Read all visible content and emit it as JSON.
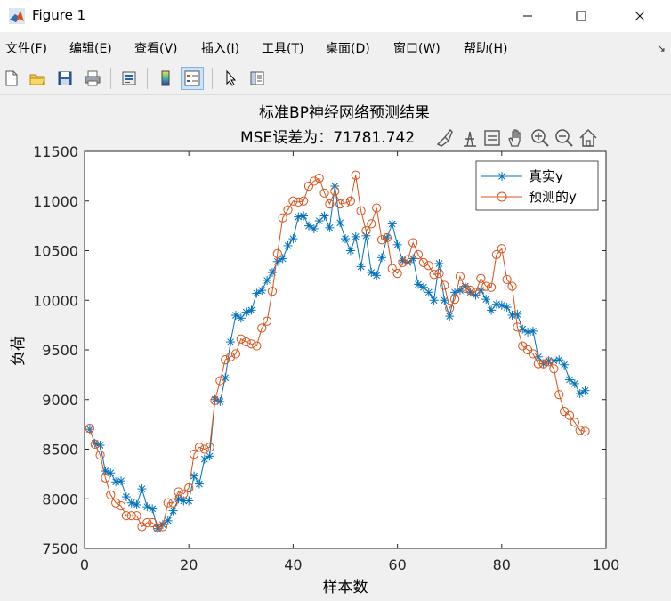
{
  "window": {
    "title": "Figure 1"
  },
  "menu": [
    "文件(F)",
    "编辑(E)",
    "查看(V)",
    "插入(I)",
    "工具(T)",
    "桌面(D)",
    "窗口(W)",
    "帮助(H)"
  ],
  "colors": {
    "series1": "#0072BD",
    "series2": "#D95319",
    "axes_bg": "#ffffff",
    "figure_bg": "#f0f0f0"
  },
  "toolbar_icons": [
    "new-figure-icon",
    "open-file-icon",
    "save-icon",
    "print-icon",
    "link-plot-icon",
    "colorbar-icon",
    "legend-icon",
    "pointer-icon",
    "property-editor-icon"
  ],
  "axes_toolbar_icons": [
    "brush-icon",
    "data-tips-icon",
    "restore-view-icon",
    "pan-icon",
    "zoom-in-icon",
    "zoom-out-icon",
    "home-icon"
  ],
  "chart_data": {
    "type": "line",
    "title": "标准BP神经网络预测结果",
    "subtitle": "MSE误差为：71781.742",
    "xlabel": "样本数",
    "ylabel": "负荷",
    "xlim": [
      0,
      100
    ],
    "ylim": [
      7500,
      11500
    ],
    "xticks": [
      0,
      20,
      40,
      60,
      80,
      100
    ],
    "yticks": [
      7500,
      8000,
      8500,
      9000,
      9500,
      10000,
      10500,
      11000,
      11500
    ],
    "grid": false,
    "legend_position": "top-right",
    "x": [
      1,
      2,
      3,
      4,
      5,
      6,
      7,
      8,
      9,
      10,
      11,
      12,
      13,
      14,
      15,
      16,
      17,
      18,
      19,
      20,
      21,
      22,
      23,
      24,
      25,
      26,
      27,
      28,
      29,
      30,
      31,
      32,
      33,
      34,
      35,
      36,
      37,
      38,
      39,
      40,
      41,
      42,
      43,
      44,
      45,
      46,
      47,
      48,
      49,
      50,
      51,
      52,
      53,
      54,
      55,
      56,
      57,
      58,
      59,
      60,
      61,
      62,
      63,
      64,
      65,
      66,
      67,
      68,
      69,
      70,
      71,
      72,
      73,
      74,
      75,
      76,
      77,
      78,
      79,
      80,
      81,
      82,
      83,
      84,
      85,
      86,
      87,
      88,
      89,
      90,
      91,
      92,
      93,
      94,
      95,
      96
    ],
    "series": [
      {
        "name": "真实y",
        "marker": "asterisk",
        "color": "#0072BD",
        "values": [
          8700,
          8560,
          8540,
          8280,
          8260,
          8170,
          8180,
          8020,
          7960,
          7940,
          8100,
          7920,
          7900,
          7700,
          7740,
          7780,
          7880,
          8000,
          7980,
          7980,
          8230,
          8150,
          8400,
          8430,
          9000,
          8980,
          9220,
          9580,
          9850,
          9820,
          9880,
          9900,
          10070,
          10100,
          10200,
          10280,
          10390,
          10420,
          10550,
          10620,
          10840,
          10850,
          10750,
          10720,
          10800,
          10850,
          10730,
          11150,
          10780,
          10620,
          10500,
          10640,
          10340,
          10650,
          10280,
          10250,
          10430,
          10630,
          10770,
          10560,
          10400,
          10380,
          10420,
          10160,
          10130,
          10080,
          10000,
          10370,
          10000,
          9840,
          10080,
          10100,
          10140,
          10080,
          10050,
          10100,
          10010,
          9900,
          9960,
          9950,
          9930,
          9850,
          9860,
          9710,
          9680,
          9690,
          9430,
          9360,
          9390,
          9390,
          9400,
          9350,
          9200,
          9160,
          9060,
          9090
        ]
      },
      {
        "name": "预测的y",
        "marker": "circle",
        "color": "#D95319",
        "values": [
          8710,
          8550,
          8440,
          8210,
          8040,
          7960,
          7930,
          7830,
          7830,
          7830,
          7720,
          7760,
          7760,
          7710,
          7720,
          7960,
          7960,
          8070,
          8050,
          8110,
          8450,
          8520,
          8500,
          8520,
          8990,
          9190,
          9400,
          9430,
          9460,
          9610,
          9580,
          9560,
          9540,
          9720,
          9790,
          10090,
          10470,
          10830,
          10910,
          11000,
          10990,
          11000,
          11150,
          11200,
          11230,
          11080,
          10970,
          11100,
          10970,
          10980,
          11000,
          11260,
          10900,
          10700,
          10770,
          10930,
          10610,
          10630,
          10320,
          10270,
          10380,
          10410,
          10580,
          10460,
          10380,
          10350,
          10260,
          10270,
          10150,
          9920,
          10010,
          10240,
          10120,
          10100,
          10080,
          10220,
          10140,
          10130,
          10460,
          10520,
          10210,
          10140,
          9730,
          9540,
          9500,
          9460,
          9360,
          9360,
          9380,
          9310,
          9050,
          8880,
          8840,
          8770,
          8690,
          8680
        ]
      }
    ]
  }
}
